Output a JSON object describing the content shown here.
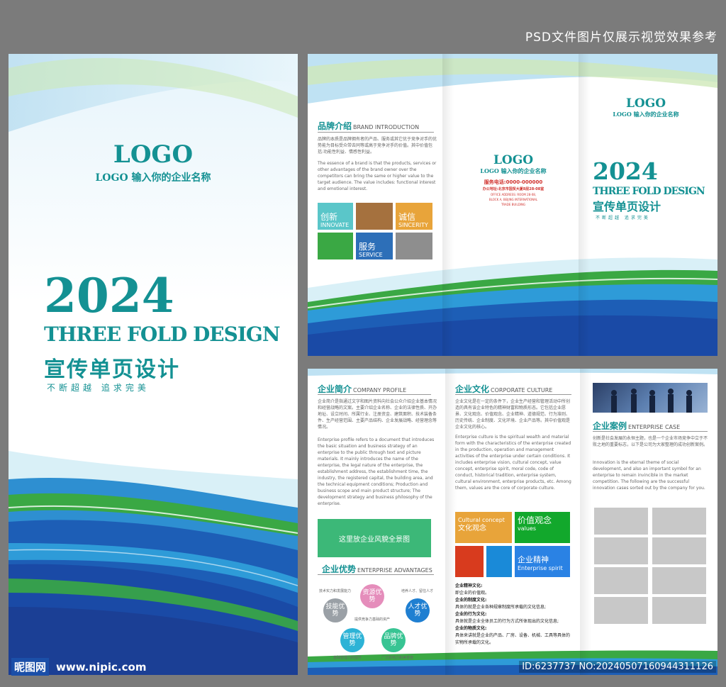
{
  "watermark": {
    "top": "PSD文件图片仅展示视觉效果参考",
    "site_logo": "昵图网",
    "site_url": "www.nipic.com",
    "id_text": "ID:6237737 NO:20240507160944311126"
  },
  "colors": {
    "accent": "#149193",
    "blue": "#1b4fa8",
    "green": "#3aa844"
  },
  "cover": {
    "logo": "LOGO",
    "logo_sub": "LOGO 输入你的企业名称",
    "year": "2024",
    "title_en": "THREE FOLD DESIGN",
    "title_cn": "宣传单页设计",
    "slogan": "不断超越  追求完美"
  },
  "inner_top": {
    "brand": {
      "title": "品牌介绍",
      "title_en": "BRAND INTRODUCTION",
      "text_cn": "品牌的本质是品牌拥有者的产品、服务或其它优于竞争对手的优势能为目标受众带去同等或高于竞争对手的价值。其中价值包括:功能性利益、情感性利益。",
      "text_en": "The essence of a brand is that the products, services or other advantages of the brand owner over the competitors can bring the same or higher value to the target audience. The value includes: functional interest and emotional interest.",
      "tiles": {
        "t1_cn": "创新",
        "t1_en": "INNOVATE",
        "t2_cn": "诚信",
        "t2_en": "SINCERITY",
        "t3_cn": "服务",
        "t3_en": "SERVICE"
      }
    },
    "middle": {
      "logo": "LOGO",
      "logo_sub": "LOGO 输入你的企业名称",
      "phone": "服务电话:0000-000000",
      "address": "办公地址:北京市国贸大厦8层28-08室",
      "addr_en1": "OFFICE ADDRESS: ROOM 28-08,",
      "addr_en2": "BLOCK A, BEIJING INTERNATIONAL",
      "addr_en3": "TRADE BUILDING"
    },
    "right": {
      "logo": "LOGO",
      "logo_sub": "LOGO 输入你的企业名称",
      "year": "2024",
      "title_en": "THREE FOLD DESIGN",
      "title_cn": "宣传单页设计",
      "slogan": "不断超越  追求完美"
    }
  },
  "inner_bottom": {
    "profile": {
      "title": "企业简介",
      "title_en": "COMPANY PROFILE",
      "text_cn": "企业简介是指通过文字和图片资料向社会公众介绍企业基本情况和经营战略的文案。主要介绍企业名称、企业的法律性质、开办地址、设立时间、所属行业、注册资金、建筑面积、技术装备条件、生产经营范围、主要产品结构、企业发展战略、经营理念等情况。",
      "text_en": "Enterprise profile refers to a document that introduces the basic situation and business strategy of an enterprise to the public through text and picture materials. It mainly introduces the name of the enterprise, the legal nature of the enterprise, the establishment address, the establishment time, the industry, the registered capital, the building area, and the technical equipment conditions; Production and business scope and main product structure; The development strategy and business philosophy of the enterprise.",
      "image_label": "这里放企业风貌全景图"
    },
    "advantages": {
      "title": "企业优势",
      "title_en": "ENTERPRISE ADVANTAGES",
      "h1": "技能优势",
      "h2": "资源优势",
      "h3": "人才优势",
      "h4": "管理优势",
      "h5": "品牌优势",
      "n1": "技术实力和发展能力",
      "n2": "提供竞争力基础的资产",
      "n3": "培养人才、留住人才",
      "n4": "基础管理力的提升",
      "n5": "广泛影响力和美誉度"
    },
    "culture": {
      "title": "企业文化",
      "title_en": "CORPORATE CULTURE",
      "text_cn": "企业文化是在一定的条件下，企业生产经营和管理活动中所创造的具有该企业特色的精神财富和物质形态。它包括企业愿景、文化观念、价值观念、企业精神、道德规范、行为准则、历史传统、企业制度、文化环境、企业产品等。其中价值观是企业文化的核心。",
      "text_en": "Enterprise culture is the spiritual wealth and material form with the characteristics of the enterprise created in the production, operation and management activities of the enterprise under certain conditions. It includes enterprise vision, cultural concept, value concept, enterprise spirit, moral code, code of conduct, historical tradition, enterprise system, cultural environment, enterprise products, etc. Among them, values are the core of corporate culture.",
      "t1_en": "Cultural concept",
      "t1_cn": "文化观念",
      "t2_cn": "价值观念",
      "t2_en": "values",
      "t3_cn": "企业精神",
      "t3_en": "Enterprise spirit",
      "items": [
        "企业精神文化:",
        "即企业的价值观。",
        "企业的制度文化:",
        "具体的就是企业各种规章制度所承载的文化信息;",
        "企业的行为文化:",
        "具体就是企业全体员工的行为方式所体现出的文化信息;",
        "企业的物质文化:",
        "具体来讲就是企业的产品、厂房、设备、机械、工具等具体的实物所承载的文化。"
      ]
    },
    "cases": {
      "title": "企业案例",
      "title_en": "ENTERPRISE CASE",
      "text_cn": "创新是社会发展的永恒主题，也是一个企业市场竞争中立于不败之地的重要标志，以下是公司为大家整理的成功创新案例。",
      "text_en": "Innovation is the eternal theme of social development, and also an important symbol for an enterprise to remain invincible in the market competition. The following are the successful innovation cases sorted out by the company for you."
    }
  }
}
